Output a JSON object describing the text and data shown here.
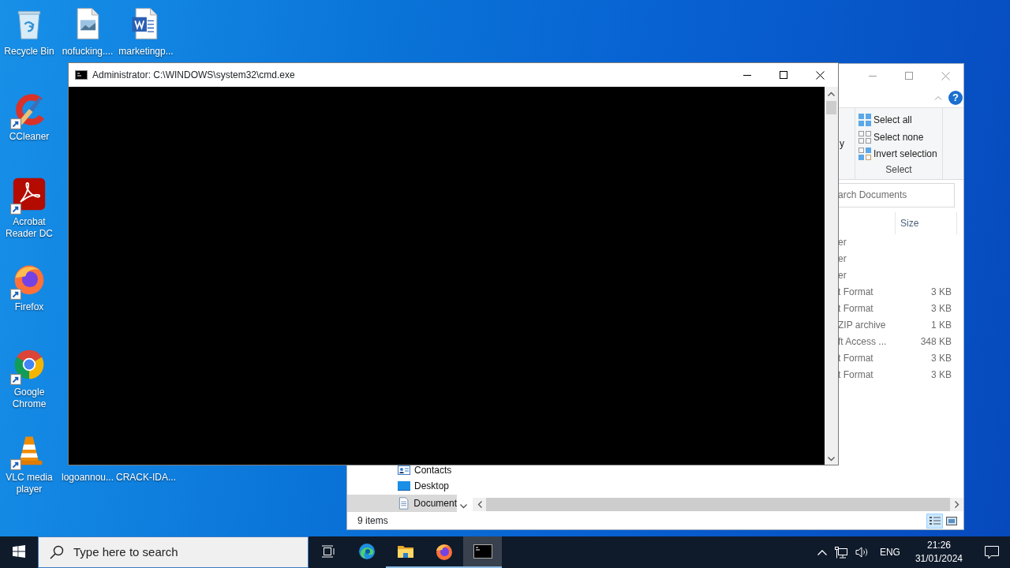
{
  "desktop_icons": [
    {
      "label": "Recycle Bin",
      "kind": "recycle-bin",
      "shortcut": false
    },
    {
      "label": "nofucking....",
      "kind": "image-file",
      "shortcut": false
    },
    {
      "label": "marketingp...",
      "kind": "word-file",
      "shortcut": false
    },
    {
      "label": "CCleaner",
      "kind": "ccleaner",
      "shortcut": true
    },
    {
      "label": "Acrobat Reader DC",
      "kind": "acrobat",
      "shortcut": true
    },
    {
      "label": "Firefox",
      "kind": "firefox",
      "shortcut": true
    },
    {
      "label": "Google Chrome",
      "kind": "chrome",
      "shortcut": true
    },
    {
      "label": "VLC media player",
      "kind": "vlc",
      "shortcut": true
    },
    {
      "label": "logoannou...",
      "kind": "hidden"
    },
    {
      "label": "CRACK-IDA...",
      "kind": "hidden"
    }
  ],
  "cmd": {
    "title": "Administrator: C:\\WINDOWS\\system32\\cmd.exe"
  },
  "explorer": {
    "help": "?",
    "ribbon_partial": "y",
    "select_group": {
      "label": "Select",
      "items": [
        {
          "label": "Select all",
          "kind": "all"
        },
        {
          "label": "Select none",
          "kind": "none"
        },
        {
          "label": "Invert selection",
          "kind": "invert"
        }
      ]
    },
    "search": {
      "placeholder": "arch Documents"
    },
    "columns": [
      "Size"
    ],
    "rows": [
      {
        "type": "er"
      },
      {
        "type": "er"
      },
      {
        "type": "er"
      },
      {
        "type": "t Format",
        "size": "3 KB"
      },
      {
        "type": "t Format",
        "size": "3 KB"
      },
      {
        "type": "ZIP archive",
        "size": "1 KB"
      },
      {
        "type": "ft Access ...",
        "size": "348 KB"
      },
      {
        "type": "t Format",
        "size": "3 KB"
      },
      {
        "type": "t Format",
        "size": "3 KB"
      }
    ],
    "nav": [
      {
        "label": "Contacts",
        "kind": "contacts",
        "selected": false
      },
      {
        "label": "Desktop",
        "kind": "desktop",
        "selected": false
      },
      {
        "label": "Document",
        "kind": "documents",
        "selected": true
      }
    ],
    "status": "9 items",
    "views": [
      {
        "kind": "details",
        "selected": true
      },
      {
        "kind": "large-icons",
        "selected": false
      }
    ]
  },
  "taskbar": {
    "search_placeholder": "Type here to search",
    "apps": [
      {
        "kind": "edge",
        "running": false,
        "active": false
      },
      {
        "kind": "folder",
        "running": true,
        "active": false
      },
      {
        "kind": "firefox",
        "running": true,
        "active": false
      },
      {
        "kind": "cmd",
        "running": true,
        "active": true
      }
    ],
    "language": "ENG",
    "time": "21:26",
    "date": "31/01/2024"
  }
}
